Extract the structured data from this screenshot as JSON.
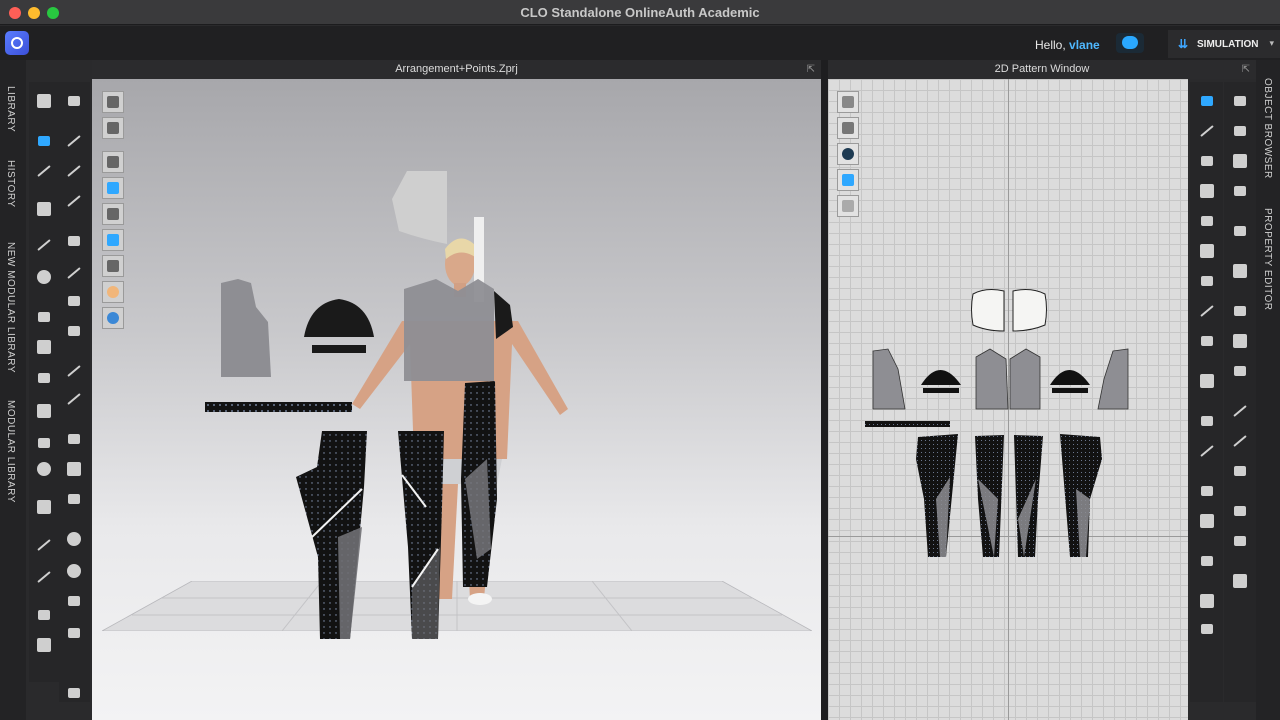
{
  "window": {
    "title": "CLO Standalone OnlineAuth Academic"
  },
  "header": {
    "greeting": "Hello,",
    "username": "vlane",
    "mode_label": "SIMULATION",
    "mode_icon": "double-chevron-down-icon"
  },
  "left_tabs": [
    "LIBRARY",
    "HISTORY",
    "NEW MODULAR LIBRARY",
    "MODULAR LIBRARY"
  ],
  "right_tabs": [
    "OBJECT BROWSER",
    "PROPERTY EDITOR"
  ],
  "view3d": {
    "title": "Arrangement+Points.Zprj"
  },
  "view2d": {
    "title": "2D Pattern Window"
  },
  "colors": {
    "accent": "#2fa8ff",
    "username": "#4fb8ff",
    "fabric": "#8e8e93",
    "sparkle_fabric": "#121212"
  }
}
